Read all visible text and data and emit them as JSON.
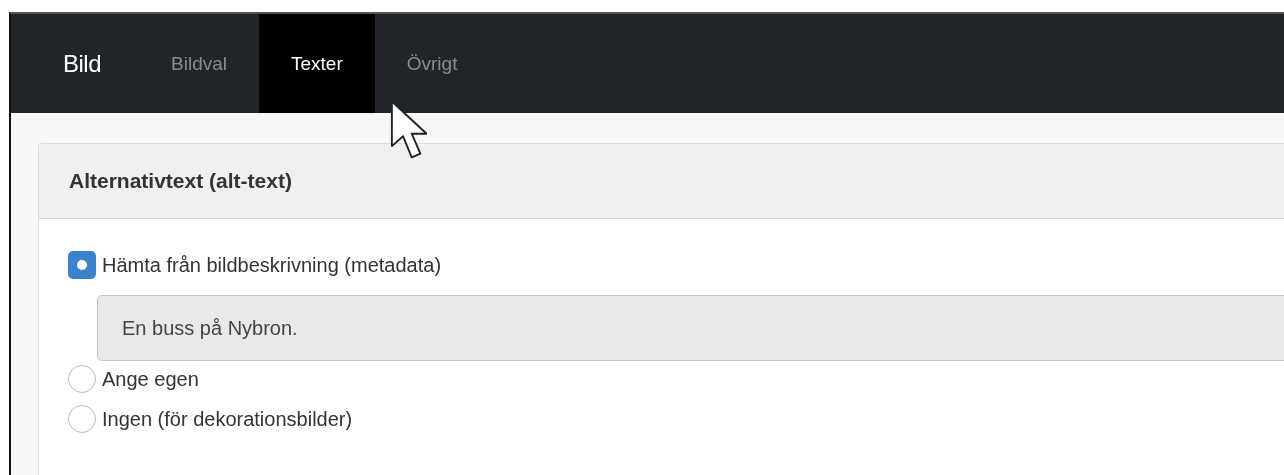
{
  "navbar": {
    "brand": "Bild",
    "tabs": [
      {
        "label": "Bildval",
        "selected": false
      },
      {
        "label": "Texter",
        "selected": true
      },
      {
        "label": "Övrigt",
        "selected": false
      }
    ]
  },
  "panel": {
    "title": "Alternativtext (alt-text)",
    "options": [
      {
        "label": "Hämta från bildbeskrivning (metadata)",
        "selected": true,
        "field": {
          "value": "En buss på Nybron.",
          "disabled": true
        }
      },
      {
        "label": "Ange egen",
        "selected": false
      },
      {
        "label": "Ingen (för dekorationsbilder)",
        "selected": false
      }
    ]
  }
}
